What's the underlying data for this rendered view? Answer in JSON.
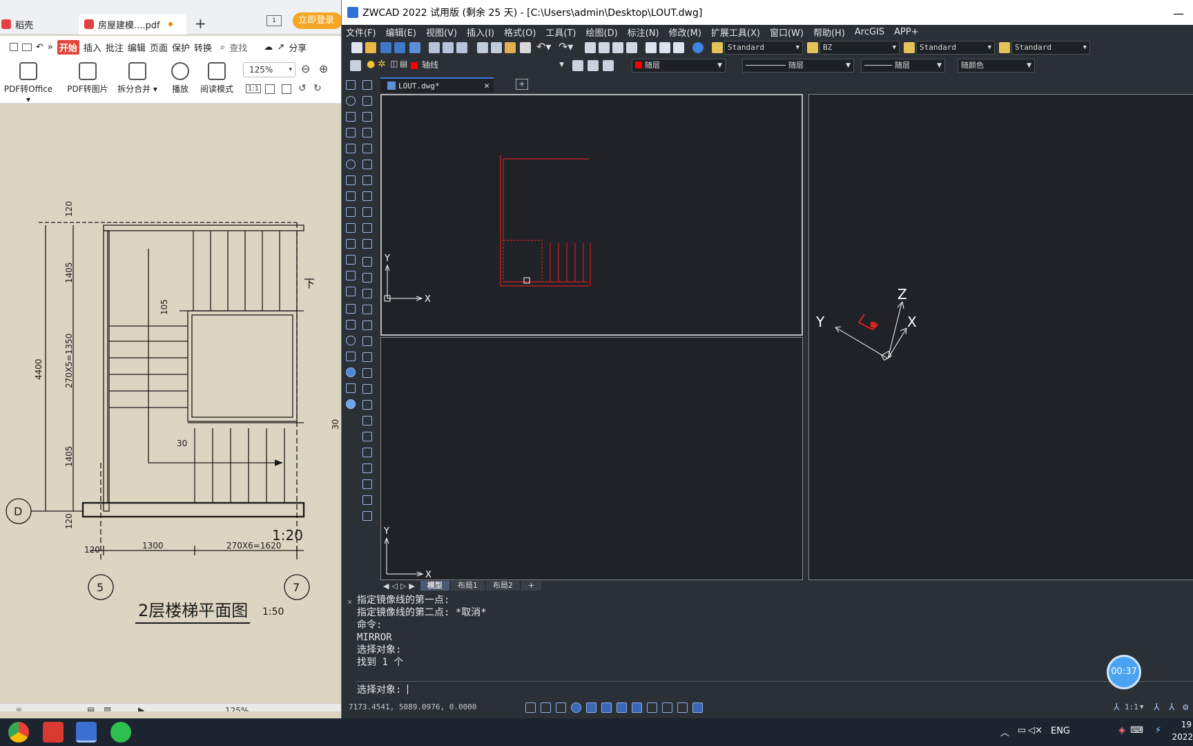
{
  "wps": {
    "tabs": [
      {
        "label": "稻壳"
      },
      {
        "label": "房屋建模....pdf"
      }
    ],
    "window_button": "1",
    "login_label": "立即登录",
    "menu": [
      "开始",
      "插入",
      "批注",
      "编辑",
      "页面",
      "保护",
      "转换"
    ],
    "search_label": "查找",
    "share_label": "分享",
    "ribbon": [
      {
        "label": "PDF转Office"
      },
      {
        "label": "PDF转图片"
      },
      {
        "label": "拆分合并"
      },
      {
        "label": "播放"
      },
      {
        "label": "阅读模式"
      }
    ],
    "zoom": "125%",
    "status_zoom": "125%",
    "drawing": {
      "title": "2层楼梯平面图",
      "title_scale": "1:50",
      "scale_overlay": "1:20",
      "dims_left": [
        "120",
        "1405",
        "270X5=1350",
        "1405",
        "120"
      ],
      "dim_total": "4400",
      "dims_bottom": [
        "120",
        "1300",
        "270X6=1620"
      ],
      "dim_105": "105",
      "dim_30a": "30",
      "dim_30b": "30",
      "down_label": "下",
      "axis_d": "D",
      "axis_5": "5",
      "axis_7": "7"
    }
  },
  "cad": {
    "title": "ZWCAD 2022 试用版 (剩余 25 天) - [C:\\Users\\admin\\Desktop\\LOUT.dwg]",
    "menu": [
      "文件(F)",
      "编辑(E)",
      "视图(V)",
      "插入(I)",
      "格式(O)",
      "工具(T)",
      "绘图(D)",
      "标注(N)",
      "修改(M)",
      "扩展工具(X)",
      "窗口(W)",
      "帮助(H)",
      "ArcGIS",
      "APP+"
    ],
    "text_style": "Standard",
    "dim_style": "BZ",
    "table_style": "Standard",
    "multileader_style": "Standard",
    "layer": "轴线",
    "color": "随层",
    "linetype": "随层",
    "lineweight": "随层",
    "plotstyle": "随颜色",
    "doc_tab": "LOUT.dwg*",
    "layout_tabs": [
      "模型",
      "布局1",
      "布局2",
      "+"
    ],
    "command_history": [
      "指定镜像线的第一点:",
      "指定镜像线的第二点: *取消*",
      "命令:",
      "MIRROR",
      "选择对象:",
      "找到 1 个"
    ],
    "command_prompt": "选择对象: ",
    "coords": "7173.4541, 5089.0976, 0.0000",
    "scale": "1:1",
    "timer": "00:37",
    "axis": {
      "x": "X",
      "y": "Y",
      "z": "Z"
    }
  },
  "taskbar": {
    "lang": "ENG",
    "clock_top": "19",
    "clock_bottom": "2022"
  }
}
